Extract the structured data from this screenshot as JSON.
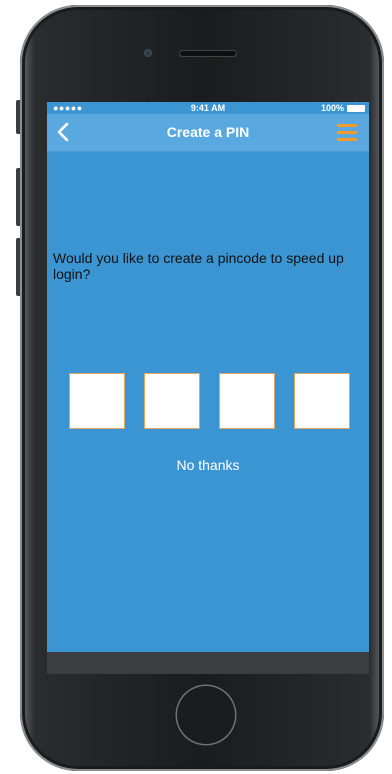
{
  "status_bar": {
    "signal": "●●●●● ",
    "time": "9:41 AM",
    "battery_percent": "100%"
  },
  "nav": {
    "back_icon": "chevron-left-icon",
    "title": "Create a PIN",
    "menu_icon": "hamburger-menu-icon",
    "menu_color": "#f39c2c"
  },
  "main": {
    "prompt": "Would you like to create a pincode to speed up login?",
    "pin_digits": [
      "",
      "",
      "",
      ""
    ],
    "skip_label": "No thanks"
  },
  "colors": {
    "background": "#3b95d3",
    "nav_bar": "#59a8e0",
    "pin_border": "#e3a560"
  }
}
